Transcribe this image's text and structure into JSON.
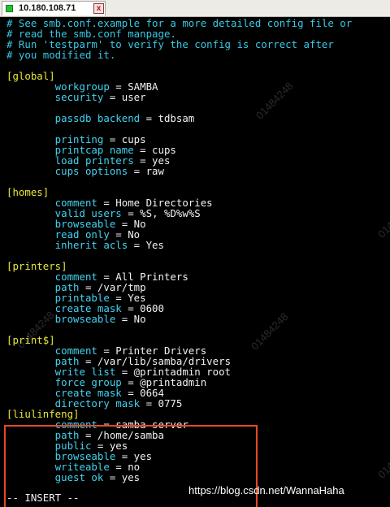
{
  "window": {
    "tab_title": "10.180.108.71",
    "close_glyph": "x",
    "status_icon": "connected-status-icon"
  },
  "colors": {
    "comment": "#37c9e6",
    "section": "#e8e83a",
    "key": "#43d2f0",
    "boolean": "#ff3cff",
    "variable": "#3b48ff",
    "highlight": "#e84727"
  },
  "lines": [
    [
      {
        "t": "# See smb.conf.example for a more detailed config file or",
        "c": "comment"
      }
    ],
    [
      {
        "t": "# read the smb.conf manpage.",
        "c": "comment"
      }
    ],
    [
      {
        "t": "# Run 'testparm' to verify the config is correct after",
        "c": "comment"
      }
    ],
    [
      {
        "t": "# you modified it.",
        "c": "comment"
      }
    ],
    [
      {
        "t": "",
        "c": "white"
      }
    ],
    [
      {
        "t": "[global]",
        "c": "section"
      }
    ],
    [
      {
        "t": "        workgroup",
        "c": "key"
      },
      {
        "t": " = SAMBA",
        "c": "white"
      }
    ],
    [
      {
        "t": "        security",
        "c": "key"
      },
      {
        "t": " = user",
        "c": "white"
      }
    ],
    [
      {
        "t": "",
        "c": "white"
      }
    ],
    [
      {
        "t": "        passdb backend",
        "c": "key"
      },
      {
        "t": " = tdbsam",
        "c": "white"
      }
    ],
    [
      {
        "t": "",
        "c": "white"
      }
    ],
    [
      {
        "t": "        printing",
        "c": "key"
      },
      {
        "t": " = cups",
        "c": "white"
      }
    ],
    [
      {
        "t": "        printcap name",
        "c": "key"
      },
      {
        "t": " = cups",
        "c": "white"
      }
    ],
    [
      {
        "t": "        load printers",
        "c": "key"
      },
      {
        "t": " = ",
        "c": "white"
      },
      {
        "t": "yes",
        "c": "boolean"
      }
    ],
    [
      {
        "t": "        cups options",
        "c": "key"
      },
      {
        "t": " = raw",
        "c": "white"
      }
    ],
    [
      {
        "t": "",
        "c": "white"
      }
    ],
    [
      {
        "t": "[homes]",
        "c": "section"
      }
    ],
    [
      {
        "t": "        comment",
        "c": "key"
      },
      {
        "t": " = Home Directories",
        "c": "white"
      }
    ],
    [
      {
        "t": "        valid users",
        "c": "key"
      },
      {
        "t": " = ",
        "c": "white"
      },
      {
        "t": "%S",
        "c": "variable"
      },
      {
        "t": ", ",
        "c": "white"
      },
      {
        "t": "%D",
        "c": "variable"
      },
      {
        "t": "%w",
        "c": "white"
      },
      {
        "t": "%S",
        "c": "variable"
      }
    ],
    [
      {
        "t": "        browseable",
        "c": "key"
      },
      {
        "t": " = ",
        "c": "white"
      },
      {
        "t": "No",
        "c": "boolean"
      }
    ],
    [
      {
        "t": "        read only",
        "c": "key"
      },
      {
        "t": " = ",
        "c": "white"
      },
      {
        "t": "No",
        "c": "boolean"
      }
    ],
    [
      {
        "t": "        inherit acls",
        "c": "key"
      },
      {
        "t": " = ",
        "c": "white"
      },
      {
        "t": "Yes",
        "c": "boolean"
      }
    ],
    [
      {
        "t": "",
        "c": "white"
      }
    ],
    [
      {
        "t": "[printers]",
        "c": "section"
      }
    ],
    [
      {
        "t": "        comment",
        "c": "key"
      },
      {
        "t": " = All Printers",
        "c": "white"
      }
    ],
    [
      {
        "t": "        path",
        "c": "key"
      },
      {
        "t": " = /var/tmp",
        "c": "white"
      }
    ],
    [
      {
        "t": "        printable",
        "c": "key"
      },
      {
        "t": " = ",
        "c": "white"
      },
      {
        "t": "Yes",
        "c": "boolean"
      }
    ],
    [
      {
        "t": "        create mask",
        "c": "key"
      },
      {
        "t": " = 0600",
        "c": "white"
      }
    ],
    [
      {
        "t": "        browseable",
        "c": "key"
      },
      {
        "t": " = ",
        "c": "white"
      },
      {
        "t": "No",
        "c": "boolean"
      }
    ],
    [
      {
        "t": "",
        "c": "white"
      }
    ],
    [
      {
        "t": "[print$]",
        "c": "section"
      }
    ],
    [
      {
        "t": "        comment",
        "c": "key"
      },
      {
        "t": " = Printer Drivers",
        "c": "white"
      }
    ],
    [
      {
        "t": "        path",
        "c": "key"
      },
      {
        "t": " = /var/lib/samba/drivers",
        "c": "white"
      }
    ],
    [
      {
        "t": "        write list",
        "c": "key"
      },
      {
        "t": " = @printadmin root",
        "c": "white"
      }
    ],
    [
      {
        "t": "        force group",
        "c": "key"
      },
      {
        "t": " = @printadmin",
        "c": "white"
      }
    ],
    [
      {
        "t": "        create mask",
        "c": "key"
      },
      {
        "t": " = 0664",
        "c": "white"
      }
    ],
    [
      {
        "t": "        directory mask",
        "c": "key"
      },
      {
        "t": " = 0775",
        "c": "white"
      }
    ],
    [
      {
        "t": "[liulinfeng]",
        "c": "section"
      }
    ],
    [
      {
        "t": "        comment",
        "c": "key"
      },
      {
        "t": " = samba server",
        "c": "white"
      }
    ],
    [
      {
        "t": "        path",
        "c": "key"
      },
      {
        "t": " = /home/samba",
        "c": "white"
      }
    ],
    [
      {
        "t": "        public",
        "c": "key"
      },
      {
        "t": " = ",
        "c": "white"
      },
      {
        "t": "yes",
        "c": "boolean"
      }
    ],
    [
      {
        "t": "        browseable",
        "c": "key"
      },
      {
        "t": " = ",
        "c": "white"
      },
      {
        "t": "yes",
        "c": "boolean"
      }
    ],
    [
      {
        "t": "        writeable",
        "c": "key"
      },
      {
        "t": " = ",
        "c": "white"
      },
      {
        "t": "no",
        "c": "boolean"
      }
    ],
    [
      {
        "t": "        guest ok",
        "c": "key"
      },
      {
        "t": " = ",
        "c": "white"
      },
      {
        "t": "yes",
        "c": "boolean"
      }
    ],
    [
      {
        "t": "",
        "c": "white"
      }
    ]
  ],
  "status_line": "-- INSERT --",
  "watermark_text": "01484248",
  "credit_text": "https://blog.csdn.net/WannaHaha"
}
